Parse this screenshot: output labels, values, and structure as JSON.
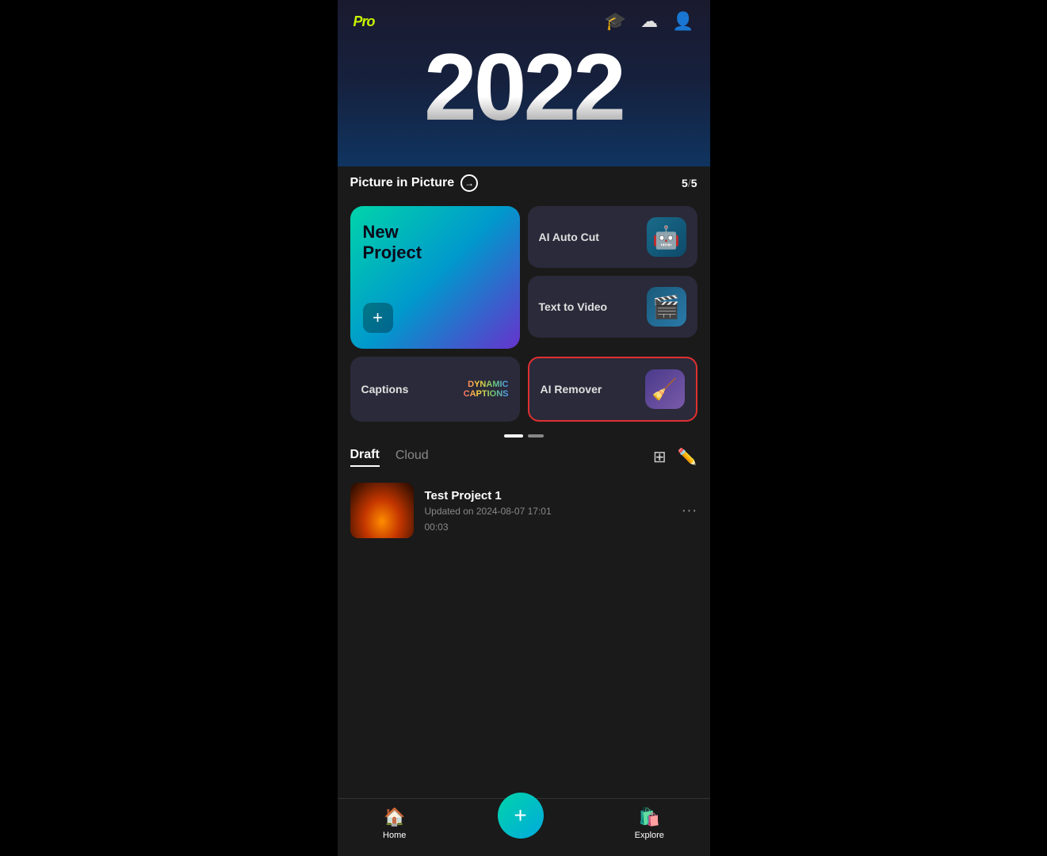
{
  "header": {
    "pro_label": "Pro",
    "icons": [
      "graduation-cap",
      "cloud",
      "user"
    ]
  },
  "hero": {
    "year": "2022"
  },
  "pip": {
    "label": "Picture in Picture",
    "current": "5",
    "total": "5"
  },
  "cards": {
    "new_project": {
      "title": "New\nProject",
      "add_label": "+"
    },
    "ai_auto_cut": {
      "label": "AI Auto Cut"
    },
    "text_to_video": {
      "label": "Text to Video"
    }
  },
  "bottom_cards": {
    "captions": {
      "label": "Captions",
      "sub_label": "DYNAMIC\nCAPTIONS"
    },
    "ai_remover": {
      "label": "AI Remover"
    }
  },
  "draft": {
    "tab_draft": "Draft",
    "tab_cloud": "Cloud"
  },
  "project": {
    "name": "Test Project 1",
    "date": "Updated on 2024-08-07 17:01",
    "duration": "00:03"
  },
  "bottom_nav": {
    "home_label": "Home",
    "explore_label": "Explore",
    "fab_label": "+"
  }
}
